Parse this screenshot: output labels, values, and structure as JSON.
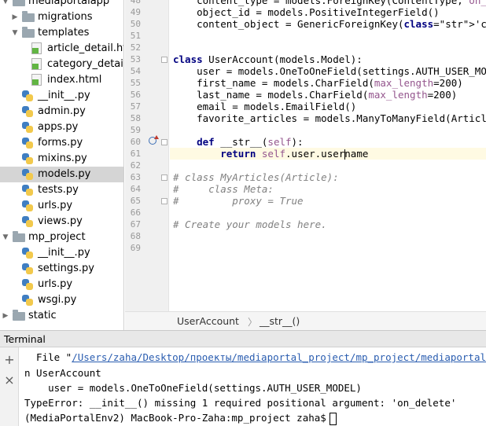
{
  "tree": {
    "items": [
      {
        "label": "mediaportalapp",
        "icon": "folder-icon",
        "arrow": "▼"
      },
      {
        "label": "migrations",
        "icon": "folder-icon",
        "arrow": "▶"
      },
      {
        "label": "templates",
        "icon": "folder-icon",
        "arrow": "▼"
      },
      {
        "label": "article_detail.html",
        "icon": "html-icon",
        "arrow": ""
      },
      {
        "label": "category_detail.html",
        "icon": "html-icon",
        "arrow": ""
      },
      {
        "label": "index.html",
        "icon": "html-icon",
        "arrow": ""
      },
      {
        "label": "__init__.py",
        "icon": "python-file-icon",
        "arrow": ""
      },
      {
        "label": "admin.py",
        "icon": "python-file-icon",
        "arrow": ""
      },
      {
        "label": "apps.py",
        "icon": "python-file-icon",
        "arrow": ""
      },
      {
        "label": "forms.py",
        "icon": "python-file-icon",
        "arrow": ""
      },
      {
        "label": "mixins.py",
        "icon": "python-file-icon",
        "arrow": ""
      },
      {
        "label": "models.py",
        "icon": "python-file-icon",
        "arrow": "",
        "selected": true
      },
      {
        "label": "tests.py",
        "icon": "python-file-icon",
        "arrow": ""
      },
      {
        "label": "urls.py",
        "icon": "python-file-icon",
        "arrow": ""
      },
      {
        "label": "views.py",
        "icon": "python-file-icon",
        "arrow": ""
      },
      {
        "label": "mp_project",
        "icon": "folder-icon",
        "arrow": "▼"
      },
      {
        "label": "__init__.py",
        "icon": "python-file-icon",
        "arrow": ""
      },
      {
        "label": "settings.py",
        "icon": "python-file-icon",
        "arrow": ""
      },
      {
        "label": "urls.py",
        "icon": "python-file-icon",
        "arrow": ""
      },
      {
        "label": "wsgi.py",
        "icon": "python-file-icon",
        "arrow": ""
      },
      {
        "label": "static",
        "icon": "folder-icon",
        "arrow": "▶"
      }
    ]
  },
  "editor": {
    "line_numbers": [
      "48",
      "49",
      "50",
      "51",
      "52",
      "53",
      "54",
      "55",
      "56",
      "57",
      "58",
      "59",
      "60",
      "61",
      "62",
      "63",
      "64",
      "65",
      "66",
      "67",
      "68",
      "69"
    ],
    "lines": [
      "    content_type = models.ForeignKey(ContentType, on_delete",
      "    object_id = models.PositiveIntegerField()",
      "    content_object = GenericForeignKey('content_type', 'o",
      "",
      "",
      "class UserAccount(models.Model):",
      "    user = models.OneToOneField(settings.AUTH_USER_MODEL)",
      "    first_name = models.CharField(max_length=200)",
      "    last_name = models.CharField(max_length=200)",
      "    email = models.EmailField()",
      "    favorite_articles = models.ManyToManyField(Article)",
      "",
      "    def __str__(self):",
      "        return self.user.username",
      "",
      "# class MyArticles(Article):",
      "#     class Meta:",
      "#         proxy = True",
      "",
      "# Create your models here.",
      "",
      ""
    ]
  },
  "breadcrumb": {
    "items": [
      "UserAccount",
      "__str__()"
    ],
    "separator": "〉"
  },
  "terminal": {
    "title": "Terminal",
    "add_tool": "+",
    "close_tool": "×",
    "file_prefix": "  File \"",
    "file_path": "/Users/zaha/Desktop/проекты/mediaportal_project/mp_project/mediaportalapp/mo",
    "lines": [
      "n UserAccount",
      "    user = models.OneToOneField(settings.AUTH_USER_MODEL)",
      "TypeError: __init__() missing 1 required positional argument: 'on_delete'"
    ],
    "prompt": "(MediaPortalEnv2) MacBook-Pro-Zaha:mp_project zaha$"
  },
  "colors": {
    "keyword": "#000080",
    "string": "#008080",
    "self": "#94558d",
    "comment": "#808080",
    "link": "#2a5db0",
    "selection": "#d5d5d5"
  }
}
